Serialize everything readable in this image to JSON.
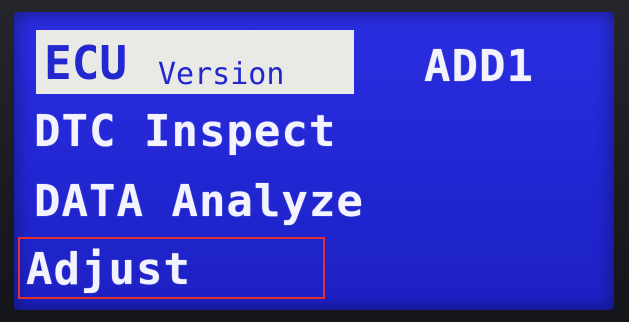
{
  "screen": {
    "background_color": "#2226d2",
    "text_color": "#f2f3ff",
    "highlight_color": "#e9e9e6",
    "selection_box_color": "#e03030"
  },
  "header": {
    "ecu_label": "ECU",
    "version_label": "Version",
    "address_label": "ADD1"
  },
  "menu": {
    "items": [
      {
        "label": "DTC Inspect"
      },
      {
        "label": "DATA Analyze"
      },
      {
        "label": "Adjust"
      }
    ]
  }
}
